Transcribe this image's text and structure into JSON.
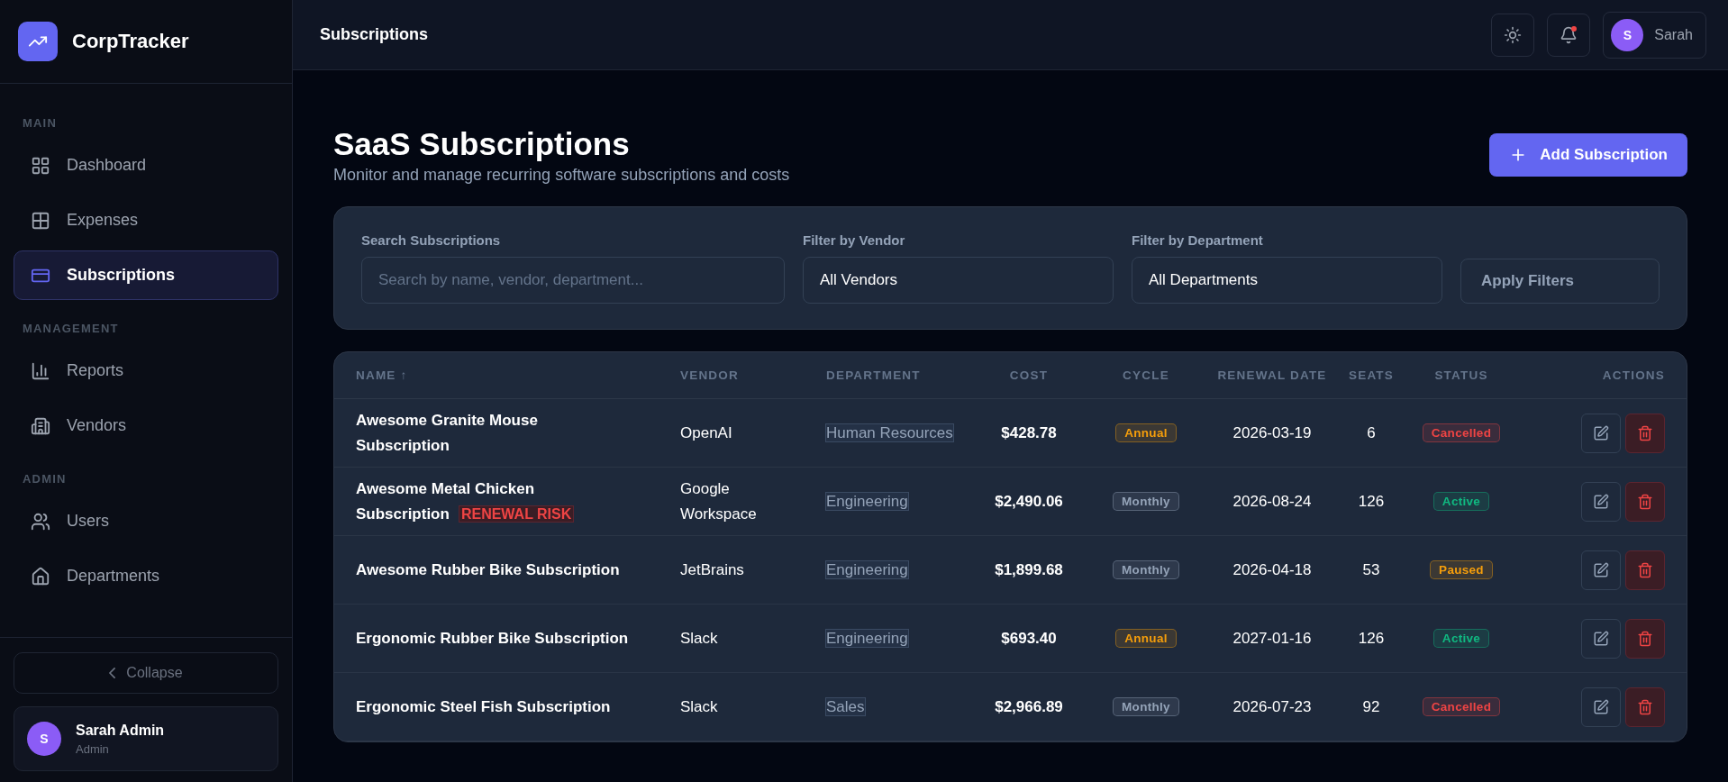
{
  "brand": {
    "name": "CorpTracker"
  },
  "sidebar": {
    "sections": [
      {
        "title": "MAIN",
        "items": [
          {
            "label": "Dashboard",
            "selected": false
          },
          {
            "label": "Expenses",
            "selected": false
          },
          {
            "label": "Subscriptions",
            "selected": true
          }
        ]
      },
      {
        "title": "MANAGEMENT",
        "items": [
          {
            "label": "Reports",
            "selected": false
          },
          {
            "label": "Vendors",
            "selected": false
          }
        ]
      },
      {
        "title": "ADMIN",
        "items": [
          {
            "label": "Users",
            "selected": false
          },
          {
            "label": "Departments",
            "selected": false
          }
        ]
      }
    ],
    "collapse": "Collapse",
    "user": {
      "initial": "S",
      "name": "Sarah Admin",
      "role": "Admin"
    }
  },
  "header": {
    "title": "Subscriptions",
    "user": {
      "initial": "S",
      "name": "Sarah"
    }
  },
  "page": {
    "title": "SaaS Subscriptions",
    "subtitle": "Monitor and manage recurring software subscriptions and costs",
    "add_button": "Add Subscription"
  },
  "filters": {
    "search": {
      "label": "Search Subscriptions",
      "placeholder": "Search by name, vendor, department..."
    },
    "vendor": {
      "label": "Filter by Vendor",
      "value": "All Vendors"
    },
    "department": {
      "label": "Filter by Department",
      "value": "All Departments"
    },
    "apply": "Apply Filters"
  },
  "table": {
    "columns": [
      "NAME ↑",
      "VENDOR",
      "DEPARTMENT",
      "COST",
      "CYCLE",
      "RENEWAL DATE",
      "SEATS",
      "STATUS",
      "ACTIONS"
    ],
    "rows": [
      {
        "name": "Awesome Granite Mouse Subscription",
        "vendor": "OpenAI",
        "department": "Human Resources",
        "cost": "$428.78",
        "cycle": {
          "label": "Annual",
          "color": "#f59e0b"
        },
        "renewal": "2026-03-19",
        "seats": "6",
        "status": {
          "label": "Cancelled",
          "color": "#ef4444"
        }
      },
      {
        "name": "Awesome Metal Chicken Subscription",
        "flag": "RENEWAL RISK",
        "vendor": "Google Workspace",
        "department": "Engineering",
        "cost": "$2,490.06",
        "cycle": {
          "label": "Monthly",
          "color": "#94a3b8"
        },
        "renewal": "2026-08-24",
        "seats": "126",
        "status": {
          "label": "Active",
          "color": "#10b981"
        }
      },
      {
        "name": "Awesome Rubber Bike Subscription",
        "vendor": "JetBrains",
        "department": "Engineering",
        "cost": "$1,899.68",
        "cycle": {
          "label": "Monthly",
          "color": "#94a3b8"
        },
        "renewal": "2026-04-18",
        "seats": "53",
        "status": {
          "label": "Paused",
          "color": "#f59e0b"
        }
      },
      {
        "name": "Ergonomic Rubber Bike Subscription",
        "vendor": "Slack",
        "department": "Engineering",
        "cost": "$693.40",
        "cycle": {
          "label": "Annual",
          "color": "#f59e0b"
        },
        "renewal": "2027-01-16",
        "seats": "126",
        "status": {
          "label": "Active",
          "color": "#10b981"
        }
      },
      {
        "name": "Ergonomic Steel Fish Subscription",
        "vendor": "Slack",
        "department": "Sales",
        "cost": "$2,966.89",
        "cycle": {
          "label": "Monthly",
          "color": "#94a3b8"
        },
        "renewal": "2026-07-23",
        "seats": "92",
        "status": {
          "label": "Cancelled",
          "color": "#ef4444"
        }
      }
    ]
  }
}
